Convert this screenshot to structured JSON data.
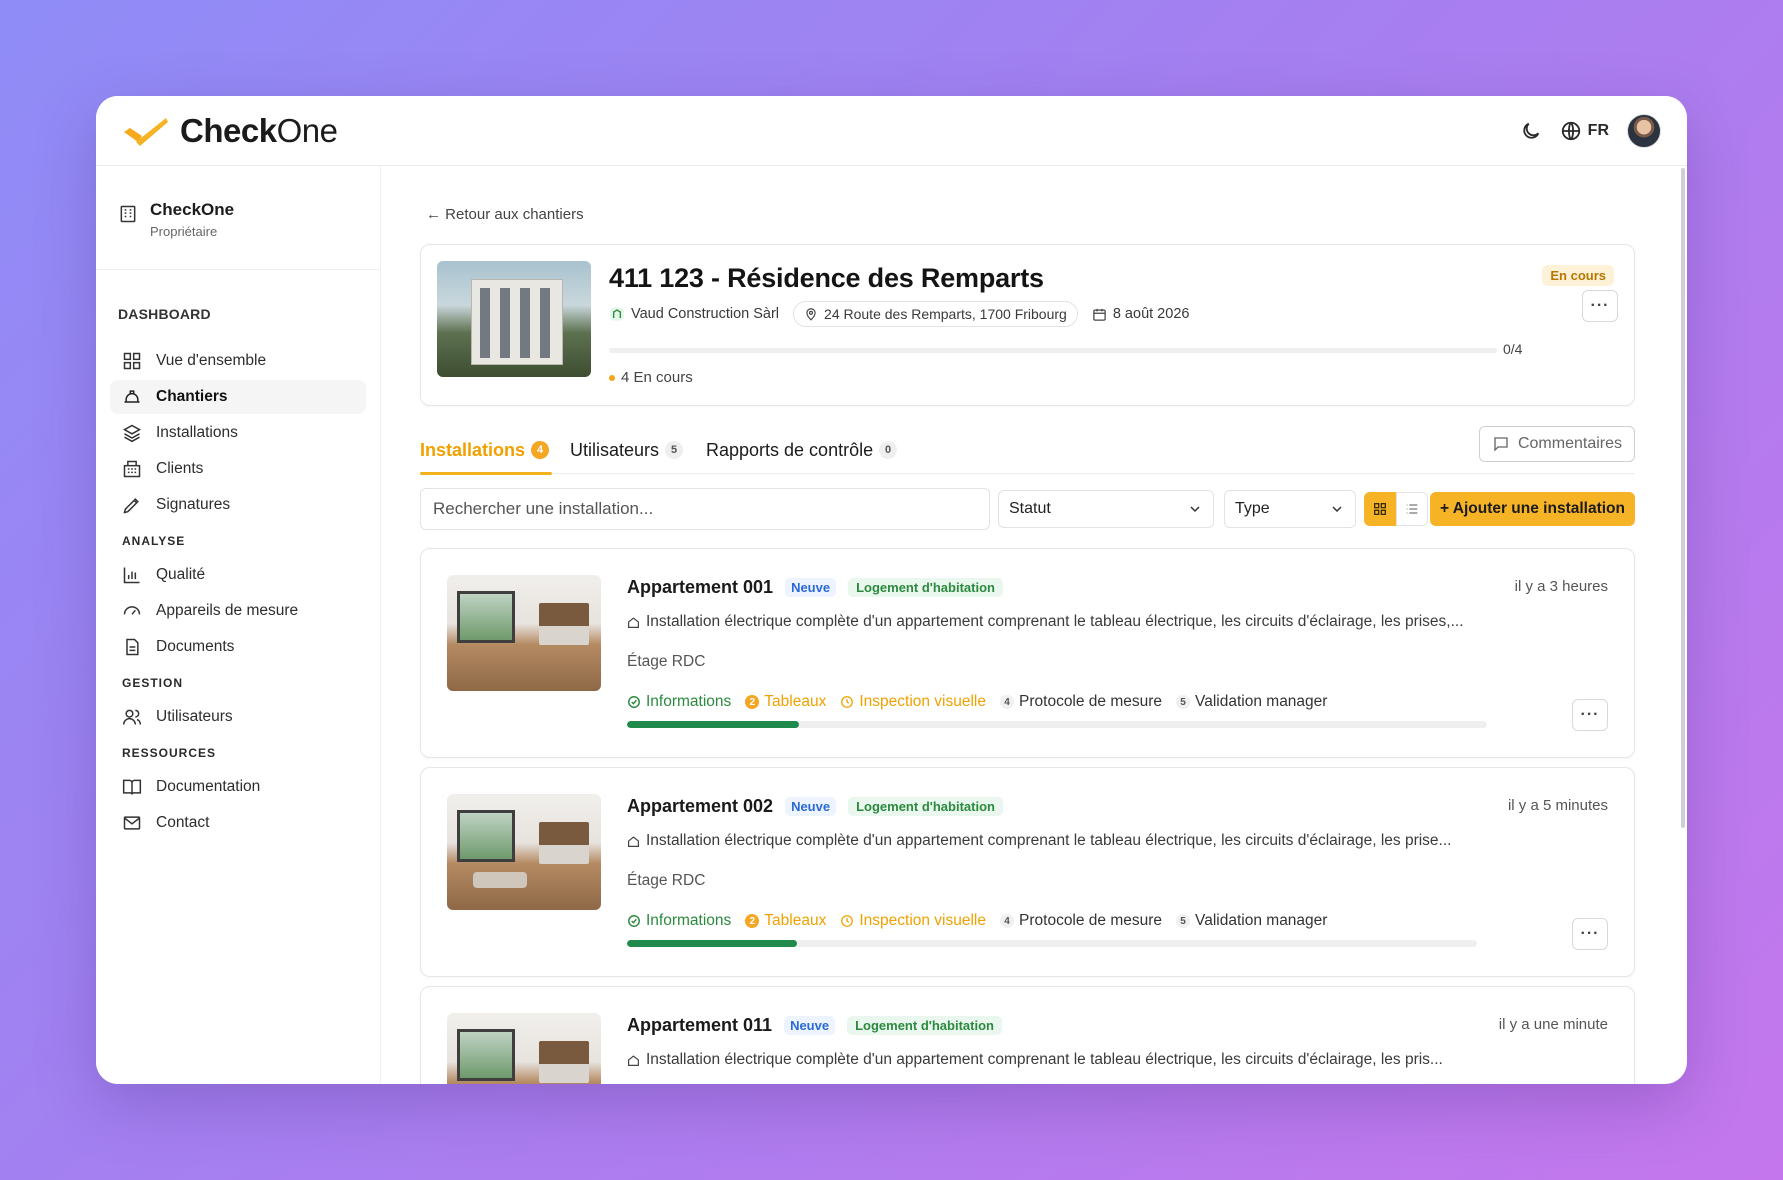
{
  "app": {
    "name_bold": "Check",
    "name_light": "One",
    "language": "FR"
  },
  "sidebar": {
    "org_name": "CheckOne",
    "org_role": "Propriétaire",
    "dashboard_heading": "DASHBOARD",
    "items": [
      {
        "label": "Vue d'ensemble",
        "icon": "grid-icon"
      },
      {
        "label": "Chantiers",
        "icon": "hardhat-icon",
        "active": true
      },
      {
        "label": "Installations",
        "icon": "layers-icon"
      },
      {
        "label": "Clients",
        "icon": "building-icon"
      },
      {
        "label": "Signatures",
        "icon": "pen-icon"
      }
    ],
    "analyse_heading": "ANALYSE",
    "analyse_items": [
      {
        "label": "Qualité",
        "icon": "bar-chart-icon"
      },
      {
        "label": "Appareils de mesure",
        "icon": "gauge-icon"
      },
      {
        "label": "Documents",
        "icon": "document-icon"
      }
    ],
    "gestion_heading": "GESTION",
    "gestion_items": [
      {
        "label": "Utilisateurs",
        "icon": "users-icon"
      }
    ],
    "ressources_heading": "RESSOURCES",
    "ressources_items": [
      {
        "label": "Documentation",
        "icon": "book-icon"
      },
      {
        "label": "Contact",
        "icon": "mail-icon"
      }
    ]
  },
  "main": {
    "back_link": "← Retour aux chantiers",
    "project": {
      "title": "411 123 - Résidence des Remparts",
      "client": "Vaud Construction Sàrl",
      "address": "24 Route des Remparts, 1700 Fribourg",
      "date": "8 août 2026",
      "status_badge": "En cours",
      "progress_text": "0/4",
      "progress": 0,
      "status_line": "4 En cours",
      "more": "···"
    },
    "tabs": [
      {
        "label": "Installations",
        "count": "4",
        "active": true
      },
      {
        "label": "Utilisateurs",
        "count": "5"
      },
      {
        "label": "Rapports de contrôle",
        "count": "0"
      }
    ],
    "comments_button": "Commentaires",
    "search_placeholder": "Rechercher une installation...",
    "filter_status": "Statut",
    "filter_type": "Type",
    "add_button": "+ Ajouter une installation",
    "installations": [
      {
        "title": "Appartement 001",
        "tag_state": "Neuve",
        "tag_type": "Logement d'habitation",
        "time": "il y a 3 heures",
        "description": "Installation électrique complète d'un appartement comprenant le tableau électrique, les circuits d'éclairage, les prises,...",
        "floor": "Étage RDC",
        "progress": 0.2
      },
      {
        "title": "Appartement 002",
        "tag_state": "Neuve",
        "tag_type": "Logement d'habitation",
        "time": "il y a 5 minutes",
        "description": "Installation électrique complète d'un appartement comprenant le tableau électrique, les circuits d'éclairage, les prise...",
        "floor": "Étage RDC",
        "progress": 0.2
      },
      {
        "title": "Appartement 011",
        "tag_state": "Neuve",
        "tag_type": "Logement d'habitation",
        "time": "il y a une minute",
        "description": "Installation électrique complète d'un appartement comprenant le tableau électrique, les circuits d'éclairage, les pris..."
      }
    ],
    "steps": [
      {
        "label": "Informations",
        "state": "done"
      },
      {
        "label": "Tableaux",
        "num": "2",
        "state": "current"
      },
      {
        "label": "Inspection visuelle",
        "state": "pending"
      },
      {
        "label": "Protocole de mesure",
        "num": "4",
        "state": "todo"
      },
      {
        "label": "Validation manager",
        "num": "5",
        "state": "todo"
      }
    ]
  },
  "colors": {
    "accent": "#f5b325",
    "success": "#1f8a4c",
    "info": "#2a6ad4"
  }
}
